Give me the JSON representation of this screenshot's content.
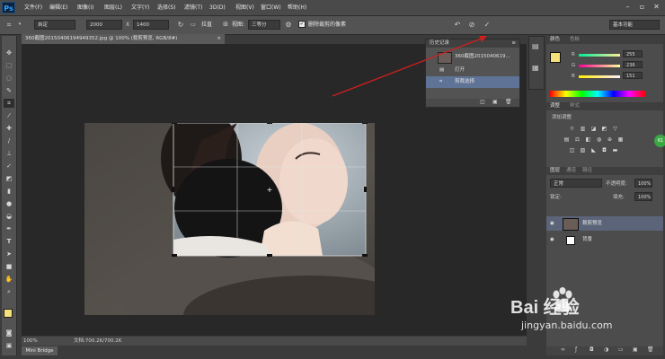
{
  "app": {
    "logo": "Ps"
  },
  "menu": [
    "文件(F)",
    "编辑(E)",
    "图像(I)",
    "图层(L)",
    "文字(Y)",
    "选择(S)",
    "滤镜(T)",
    "3D(D)",
    "视图(V)",
    "窗口(W)",
    "帮助(H)"
  ],
  "options": {
    "ratio": "自定",
    "width": "2000",
    "x": "X",
    "height": "1400",
    "straighten": "拉直",
    "view_label": "视图:",
    "view": "三等分",
    "delete_cropped": "删除裁剪的像素",
    "workspace": "基本功能"
  },
  "document": {
    "tab": "360截图20150406194949352.jpg @ 100% (裁剪预览, RGB/8#)",
    "zoom": "100%",
    "doc_info": "文档:700.2K/700.2K",
    "mini_bridge": "Mini Bridge"
  },
  "history": {
    "title": "历史记录",
    "snapshot": "360截图2015040619...",
    "items": [
      "打开",
      "剪裁选择"
    ]
  },
  "color_panel": {
    "tabs": [
      "颜色",
      "色板"
    ],
    "r": "255",
    "g": "236",
    "b": "151",
    "accent": "#f5e17a"
  },
  "adjustments": {
    "tabs": [
      "调整",
      "样式"
    ],
    "subtitle": "添加调整"
  },
  "layers": {
    "tabs": [
      "图层",
      "通道",
      "路径"
    ],
    "kind": "正常",
    "opacity_label": "不透明度:",
    "opacity": "100%",
    "fill_label": "填充:",
    "fill": "100%",
    "lock_label": "锁定:",
    "items": [
      {
        "name": "裁剪预览"
      },
      {
        "name": "背景"
      }
    ]
  },
  "watermark": {
    "text": "Bai 经验",
    "url": "jingyan.baidu.com"
  },
  "annotation_color": "#cc1f1f"
}
